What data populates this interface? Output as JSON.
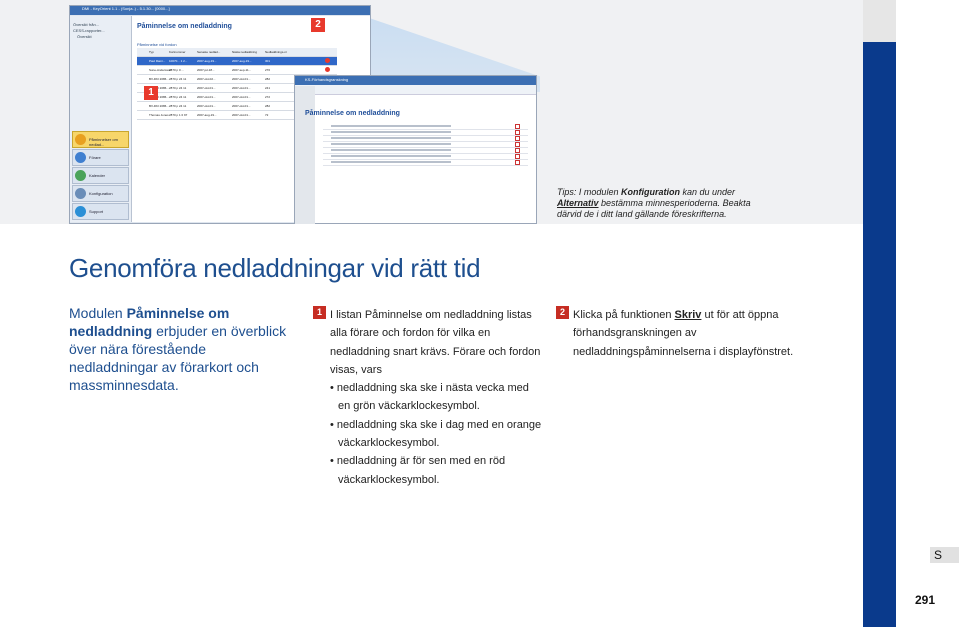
{
  "screenshot": {
    "window_title": "DMI - KeyOrient 1.1 - (Sonja..) - 5.1.30... [0000...]",
    "nav_tree": [
      "Översikt från...",
      "CESS-rapporter...",
      "Översikt"
    ],
    "nav_buttons": [
      "Påminnelser om nedlad...",
      "Förare",
      "Kalender",
      "Konfiguration",
      "Support"
    ],
    "main_title": "Påminnelse om nedladdning",
    "table_filter": "Påminnelse vid fordon",
    "table_headers": [
      "Typ",
      "Kortnummer",
      "Senaste nedlad...",
      "Nästa nedladdning",
      "Nedladdnings-nr"
    ],
    "rows": [
      {
        "name": "Paul Rami...",
        "card": "10070... 1 2...",
        "last": "2007-aug-19...",
        "next": "2007-aug-19...",
        "nr": "301",
        "selected": true,
        "alarm": "#e8392c"
      },
      {
        "name": "Sune-Andersson",
        "card": "2870 p 0 ...",
        "last": "2007-jul-18...",
        "next": "2007-sep-11...",
        "nr": "276",
        "selected": false,
        "alarm": "#e8392c"
      },
      {
        "name": "BV-DKI 2086...",
        "card": "2870 p 24 11",
        "last": "2007-okt-02...",
        "next": "2007-okt-01...",
        "nr": "282",
        "selected": false,
        "alarm": "#e08a2a"
      },
      {
        "name": "BV-DKI 2086...",
        "card": "2870 p 24 11",
        "last": "2007-okt-01...",
        "next": "2007-okt-01...",
        "nr": "241",
        "selected": false,
        "alarm": "#e08a2a"
      },
      {
        "name": "BV-DKI 2086...",
        "card": "2870 p 24 11",
        "last": "2007-okt-01...",
        "next": "2007-okt-01...",
        "nr": "272",
        "selected": false,
        "alarm": "#e08a2a"
      },
      {
        "name": "BV-DKI 2086...",
        "card": "2870 p 24 11",
        "last": "2007-okt-01...",
        "next": "2007-okt-01...",
        "nr": "282",
        "selected": false,
        "alarm": "#3aa84a"
      },
      {
        "name": "Thomas Jones",
        "card": "2870 p 1 0 97",
        "last": "2007-aug-19...",
        "next": "2007-okt-01...",
        "nr": "72",
        "selected": false,
        "alarm": "#3aa84a"
      }
    ],
    "badge_1": "1",
    "badge_2": "2"
  },
  "preview_window": {
    "window_title": "KS-Förhandsgranskning",
    "title": "Påminnelse om nedladdning"
  },
  "tips": {
    "prefix": "Tips: I modulen ",
    "bold1": "Konfiguration",
    "mid": " kan du under ",
    "link": "Alternativ",
    "rest": " bestämma minnesperioderna. Beakta därvid de i ditt land gällande föreskrifterna."
  },
  "heading": "Genomföra nedladdningar vid rätt tid",
  "intro": {
    "part1": "Modulen ",
    "bold": "Påminnelse om nedladdning",
    "part2": " erbjuder en överblick över nära förestående nedladdningar av förarkort och massminnesdata."
  },
  "step1": {
    "num": "1",
    "text": "I listan Påminnelse om nedladdning listas alla förare och fordon för vilka en nedladdning snart krävs. Förare och fordon visas, vars",
    "bullets": [
      "• nedladdning ska ske i nästa vecka med en grön väckarklockesymbol.",
      "• nedladdning ska ske i dag med en orange väckarklockesymbol.",
      "• nedladdning är för sen med en röd väckarklockesymbol."
    ]
  },
  "step2": {
    "num": "2",
    "pre": "Klicka på funktionen ",
    "link": "Skriv",
    "post": " ut för att öppna förhandsgranskningen av nedladdningspåminnelserna i displayfönstret."
  },
  "side_tab": "S",
  "page_number": "291",
  "colors": {
    "accent_blue": "#1e4f8f",
    "side_bar": "#0a3a8c",
    "badge_red": "#c62d23"
  }
}
